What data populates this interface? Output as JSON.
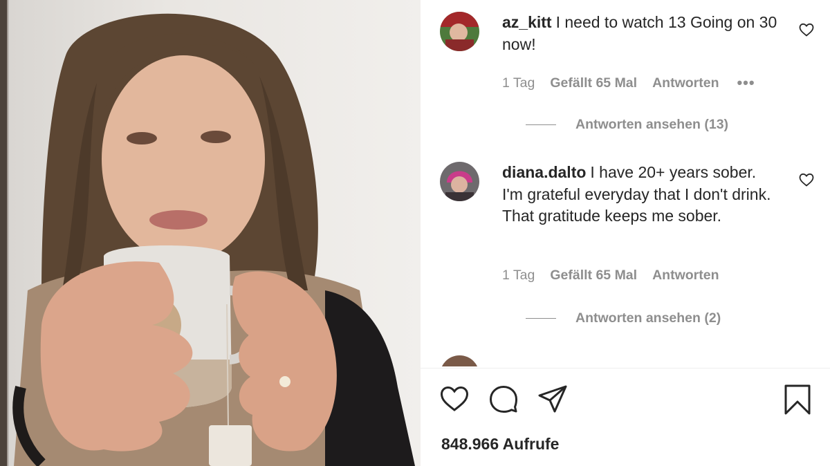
{
  "post": {
    "comments": [
      {
        "username": "az_kitt",
        "text": "I need to watch 13 Going on 30 now!",
        "time": "1 Tag",
        "likes": "Gefällt 65 Mal",
        "reply_label": "Antworten",
        "more": "•••",
        "view_replies": "Antworten ansehen (13)"
      },
      {
        "username": "diana.dalto",
        "text": "I have 20+ years sober. I'm grateful everyday that I don't drink. That gratitude keeps me sober.",
        "time": "1 Tag",
        "likes": "Gefällt 65 Mal",
        "reply_label": "Antworten",
        "view_replies": "Antworten ansehen (2)"
      },
      {
        "username": "",
        "text": ""
      }
    ],
    "actions": {
      "like_icon": "heart-icon",
      "comment_icon": "comment-bubble-icon",
      "share_icon": "paper-plane-icon",
      "save_icon": "bookmark-icon"
    },
    "views": "848.966 Aufrufe"
  },
  "colors": {
    "text": "#262626",
    "muted": "#8e8e8e",
    "divider": "#efefef"
  }
}
